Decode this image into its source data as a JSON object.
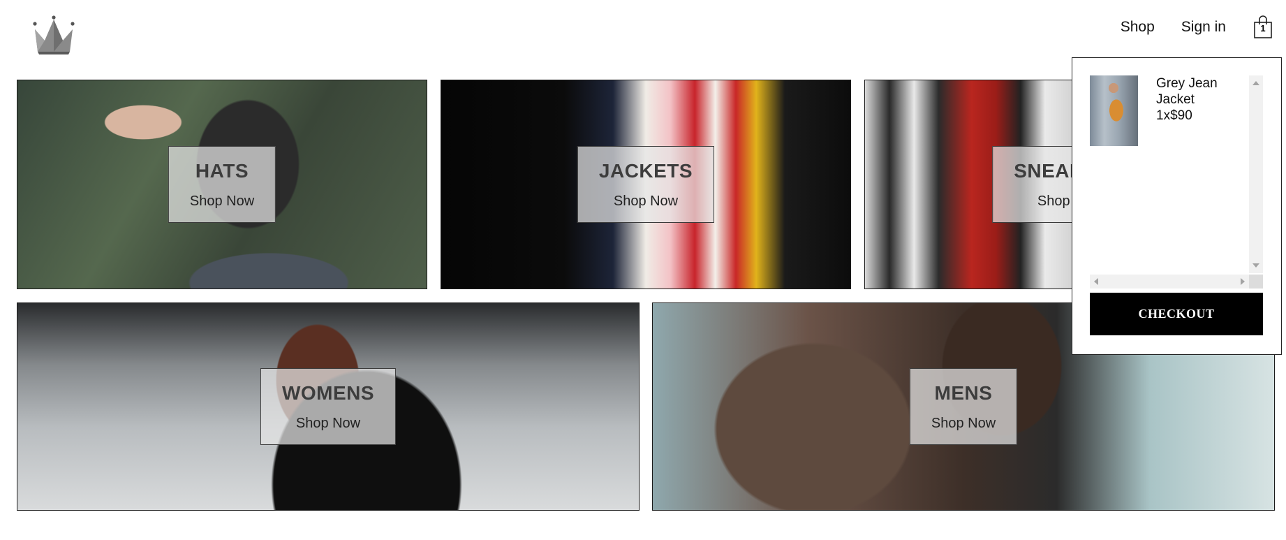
{
  "header": {
    "logo_icon": "crown-icon",
    "nav": {
      "shop_label": "Shop",
      "signin_label": "Sign in"
    },
    "cart_icon": "shopping-bag-icon",
    "cart_count": "1"
  },
  "directory": [
    {
      "title": "HATS",
      "subtitle": "Shop Now"
    },
    {
      "title": "JACKETS",
      "subtitle": "Shop Now"
    },
    {
      "title": "SNEAKERS",
      "subtitle": "Shop Now"
    },
    {
      "title": "WOMENS",
      "subtitle": "Shop Now"
    },
    {
      "title": "MENS",
      "subtitle": "Shop Now"
    }
  ],
  "cart_dropdown": {
    "items": [
      {
        "name": "Grey Jean Jacket",
        "quantity_price": "1x$90"
      }
    ],
    "checkout_label": "CHECKOUT"
  }
}
